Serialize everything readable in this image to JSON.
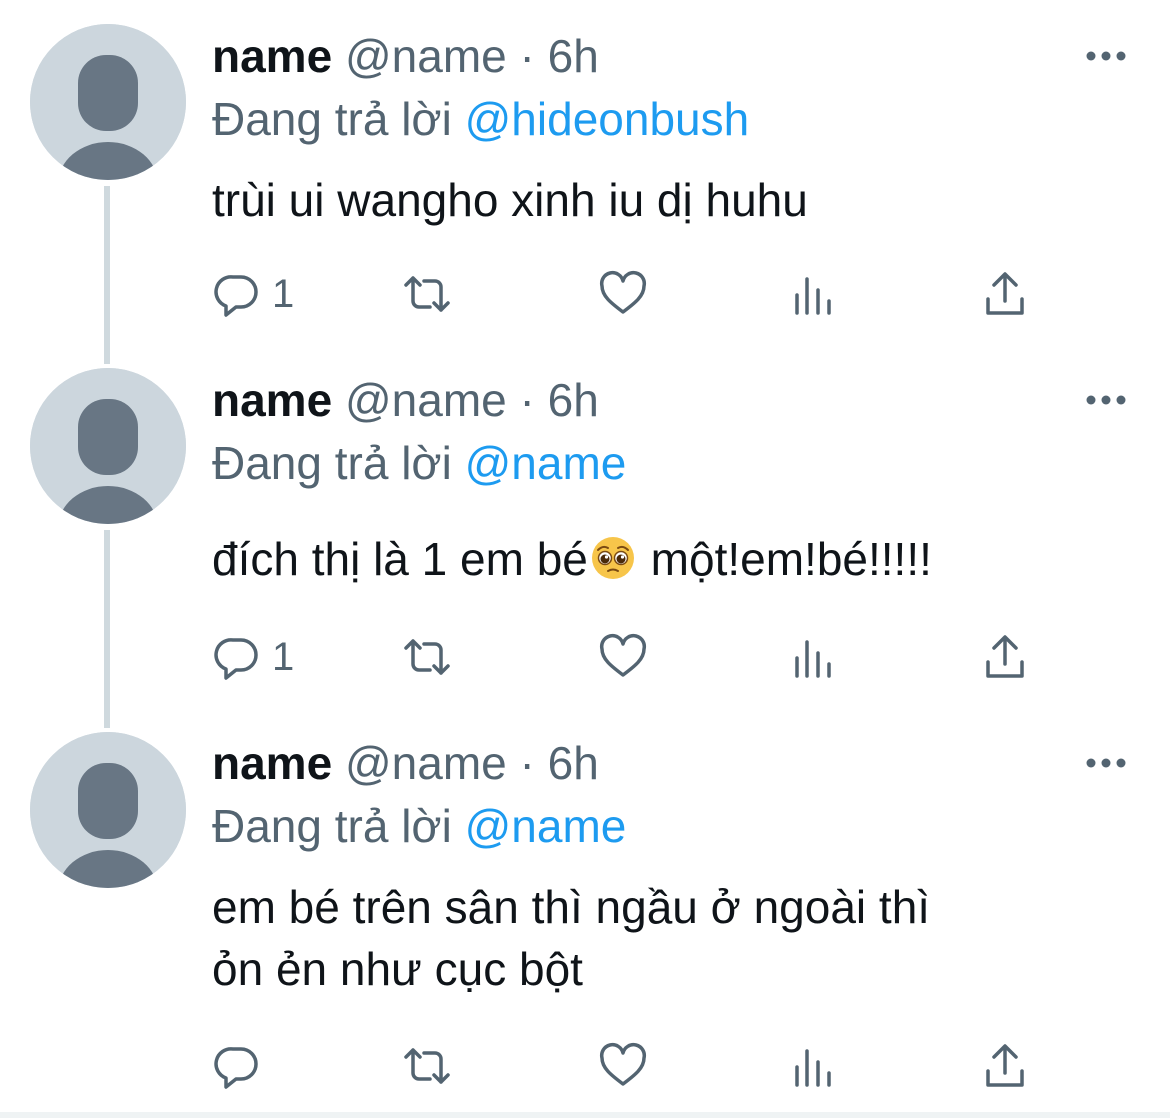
{
  "colors": {
    "text": "#0f1419",
    "secondary": "#536471",
    "link": "#1d9bf0",
    "avatar": "#ccd6dd",
    "avatar_figure": "#687684"
  },
  "tweets": [
    {
      "display_name": "name",
      "handle": "@name",
      "separator": "·",
      "time": "6h",
      "replying_label": "Đang trả lời",
      "replying_to": "@hideonbush",
      "text_lines": [
        "trùi ui wangho xinh iu dị huhu"
      ],
      "reply_count": "1",
      "icons": [
        "reply-icon",
        "retweet-icon",
        "like-icon",
        "views-icon",
        "share-icon",
        "more-icon"
      ]
    },
    {
      "display_name": "name",
      "handle": "@name",
      "separator": "·",
      "time": "6h",
      "replying_label": "Đang trả lời",
      "replying_to": "@name",
      "text_before_emoji": "đích thị là 1 em bé",
      "emoji": "pleading-face-emoji",
      "text_after_emoji": " một!em!bé!!!!!",
      "reply_count": "1",
      "icons": [
        "reply-icon",
        "retweet-icon",
        "like-icon",
        "views-icon",
        "share-icon",
        "more-icon"
      ]
    },
    {
      "display_name": "name",
      "handle": "@name",
      "separator": "·",
      "time": "6h",
      "replying_label": "Đang trả lời",
      "replying_to": "@name",
      "text_lines": [
        "em bé trên sân thì ngầu ở ngoài thì",
        "ỏn ẻn như cục bột"
      ],
      "reply_count": "",
      "icons": [
        "reply-icon",
        "retweet-icon",
        "like-icon",
        "views-icon",
        "share-icon",
        "more-icon"
      ]
    }
  ]
}
